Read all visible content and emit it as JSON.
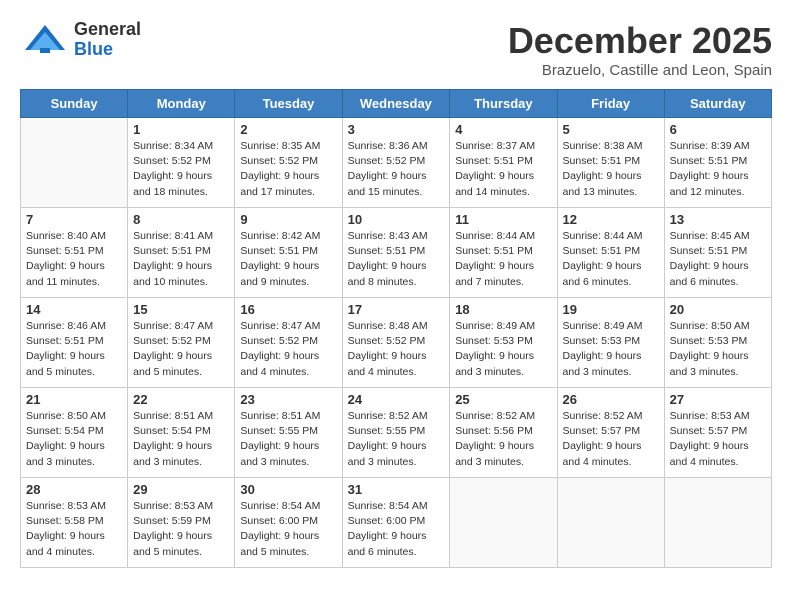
{
  "header": {
    "logo_general": "General",
    "logo_blue": "Blue",
    "month_title": "December 2025",
    "location": "Brazuelo, Castille and Leon, Spain"
  },
  "days_of_week": [
    "Sunday",
    "Monday",
    "Tuesday",
    "Wednesday",
    "Thursday",
    "Friday",
    "Saturday"
  ],
  "weeks": [
    [
      {
        "day": "",
        "info": ""
      },
      {
        "day": "1",
        "info": "Sunrise: 8:34 AM\nSunset: 5:52 PM\nDaylight: 9 hours\nand 18 minutes."
      },
      {
        "day": "2",
        "info": "Sunrise: 8:35 AM\nSunset: 5:52 PM\nDaylight: 9 hours\nand 17 minutes."
      },
      {
        "day": "3",
        "info": "Sunrise: 8:36 AM\nSunset: 5:52 PM\nDaylight: 9 hours\nand 15 minutes."
      },
      {
        "day": "4",
        "info": "Sunrise: 8:37 AM\nSunset: 5:51 PM\nDaylight: 9 hours\nand 14 minutes."
      },
      {
        "day": "5",
        "info": "Sunrise: 8:38 AM\nSunset: 5:51 PM\nDaylight: 9 hours\nand 13 minutes."
      },
      {
        "day": "6",
        "info": "Sunrise: 8:39 AM\nSunset: 5:51 PM\nDaylight: 9 hours\nand 12 minutes."
      }
    ],
    [
      {
        "day": "7",
        "info": "Sunrise: 8:40 AM\nSunset: 5:51 PM\nDaylight: 9 hours\nand 11 minutes."
      },
      {
        "day": "8",
        "info": "Sunrise: 8:41 AM\nSunset: 5:51 PM\nDaylight: 9 hours\nand 10 minutes."
      },
      {
        "day": "9",
        "info": "Sunrise: 8:42 AM\nSunset: 5:51 PM\nDaylight: 9 hours\nand 9 minutes."
      },
      {
        "day": "10",
        "info": "Sunrise: 8:43 AM\nSunset: 5:51 PM\nDaylight: 9 hours\nand 8 minutes."
      },
      {
        "day": "11",
        "info": "Sunrise: 8:44 AM\nSunset: 5:51 PM\nDaylight: 9 hours\nand 7 minutes."
      },
      {
        "day": "12",
        "info": "Sunrise: 8:44 AM\nSunset: 5:51 PM\nDaylight: 9 hours\nand 6 minutes."
      },
      {
        "day": "13",
        "info": "Sunrise: 8:45 AM\nSunset: 5:51 PM\nDaylight: 9 hours\nand 6 minutes."
      }
    ],
    [
      {
        "day": "14",
        "info": "Sunrise: 8:46 AM\nSunset: 5:51 PM\nDaylight: 9 hours\nand 5 minutes."
      },
      {
        "day": "15",
        "info": "Sunrise: 8:47 AM\nSunset: 5:52 PM\nDaylight: 9 hours\nand 5 minutes."
      },
      {
        "day": "16",
        "info": "Sunrise: 8:47 AM\nSunset: 5:52 PM\nDaylight: 9 hours\nand 4 minutes."
      },
      {
        "day": "17",
        "info": "Sunrise: 8:48 AM\nSunset: 5:52 PM\nDaylight: 9 hours\nand 4 minutes."
      },
      {
        "day": "18",
        "info": "Sunrise: 8:49 AM\nSunset: 5:53 PM\nDaylight: 9 hours\nand 3 minutes."
      },
      {
        "day": "19",
        "info": "Sunrise: 8:49 AM\nSunset: 5:53 PM\nDaylight: 9 hours\nand 3 minutes."
      },
      {
        "day": "20",
        "info": "Sunrise: 8:50 AM\nSunset: 5:53 PM\nDaylight: 9 hours\nand 3 minutes."
      }
    ],
    [
      {
        "day": "21",
        "info": "Sunrise: 8:50 AM\nSunset: 5:54 PM\nDaylight: 9 hours\nand 3 minutes."
      },
      {
        "day": "22",
        "info": "Sunrise: 8:51 AM\nSunset: 5:54 PM\nDaylight: 9 hours\nand 3 minutes."
      },
      {
        "day": "23",
        "info": "Sunrise: 8:51 AM\nSunset: 5:55 PM\nDaylight: 9 hours\nand 3 minutes."
      },
      {
        "day": "24",
        "info": "Sunrise: 8:52 AM\nSunset: 5:55 PM\nDaylight: 9 hours\nand 3 minutes."
      },
      {
        "day": "25",
        "info": "Sunrise: 8:52 AM\nSunset: 5:56 PM\nDaylight: 9 hours\nand 3 minutes."
      },
      {
        "day": "26",
        "info": "Sunrise: 8:52 AM\nSunset: 5:57 PM\nDaylight: 9 hours\nand 4 minutes."
      },
      {
        "day": "27",
        "info": "Sunrise: 8:53 AM\nSunset: 5:57 PM\nDaylight: 9 hours\nand 4 minutes."
      }
    ],
    [
      {
        "day": "28",
        "info": "Sunrise: 8:53 AM\nSunset: 5:58 PM\nDaylight: 9 hours\nand 4 minutes."
      },
      {
        "day": "29",
        "info": "Sunrise: 8:53 AM\nSunset: 5:59 PM\nDaylight: 9 hours\nand 5 minutes."
      },
      {
        "day": "30",
        "info": "Sunrise: 8:54 AM\nSunset: 6:00 PM\nDaylight: 9 hours\nand 5 minutes."
      },
      {
        "day": "31",
        "info": "Sunrise: 8:54 AM\nSunset: 6:00 PM\nDaylight: 9 hours\nand 6 minutes."
      },
      {
        "day": "",
        "info": ""
      },
      {
        "day": "",
        "info": ""
      },
      {
        "day": "",
        "info": ""
      }
    ]
  ]
}
